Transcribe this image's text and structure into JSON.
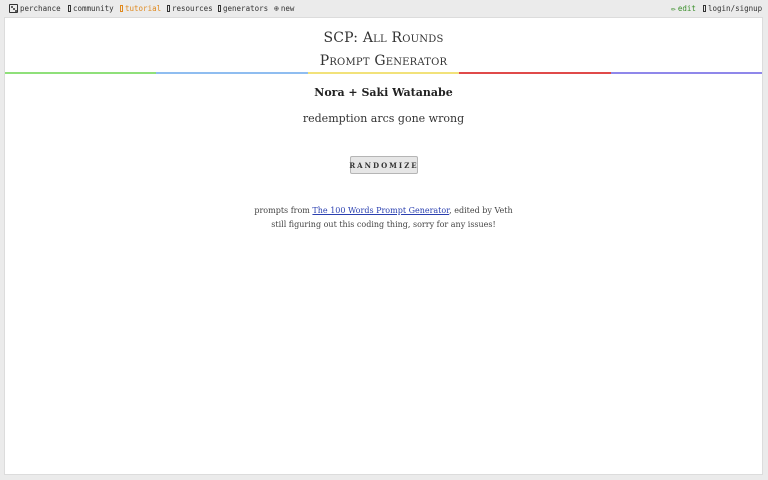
{
  "topbar": {
    "left": [
      {
        "label": "perchance",
        "icon": "dice-icon"
      },
      {
        "label": "community",
        "icon": "community-icon"
      },
      {
        "label": "tutorial",
        "icon": "tutorial-icon"
      },
      {
        "label": "resources",
        "icon": "resources-icon"
      },
      {
        "label": "generators",
        "icon": "generators-icon"
      },
      {
        "label": "new",
        "icon": "plus-circle-icon"
      }
    ],
    "right": [
      {
        "label": "edit",
        "icon": "pencil-icon"
      },
      {
        "label": "login/signup",
        "icon": "user-icon"
      }
    ]
  },
  "header": {
    "title_line1": "SCP: All Rounds",
    "title_line2": "Prompt Generator"
  },
  "rainbow_colors": [
    "#8fe07a",
    "#8fbdf0",
    "#f2e27a",
    "#e04a4a",
    "#8f87ea"
  ],
  "main": {
    "names": "Nora + Saki Watanabe",
    "prompt": "redemption arcs gone wrong",
    "randomize_label": "RANDOMIZE"
  },
  "credits": {
    "prefix": "prompts from ",
    "link_text": "The 100 Words Prompt Generator",
    "suffix": ", edited by Veth",
    "line2": "still figuring out this coding thing, sorry for any issues!"
  },
  "colors": {
    "accent_tutorial": "#e0891e",
    "accent_edit": "#3a8f2a",
    "link": "#2a3fb0"
  }
}
